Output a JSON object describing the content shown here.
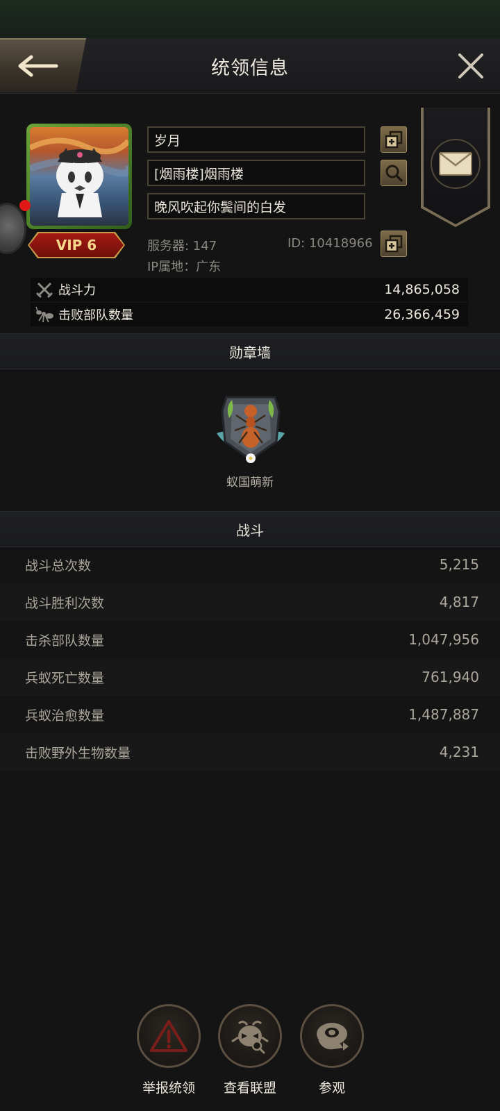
{
  "header": {
    "title": "统领信息"
  },
  "profile": {
    "name": "岁月",
    "alliance": "[烟雨楼]烟雨楼",
    "signature": "晚风吹起你鬓间的白发",
    "vip": "VIP 6",
    "server": "服务器: 147",
    "id": "ID: 10418966",
    "ip_location": "IP属地：广东"
  },
  "stats": [
    {
      "label": "战斗力",
      "value": "14,865,058",
      "icon": "crossed-swords-icon"
    },
    {
      "label": "击败部队数量",
      "value": "26,366,459",
      "icon": "ant-icon"
    }
  ],
  "medal_section": {
    "title": "勋章墙",
    "medal_name": "蚁国萌新"
  },
  "battle_section": {
    "title": "战斗",
    "rows": [
      {
        "label": "战斗总次数",
        "value": "5,215"
      },
      {
        "label": "战斗胜利次数",
        "value": "4,817"
      },
      {
        "label": "击杀部队数量",
        "value": "1,047,956"
      },
      {
        "label": "兵蚁死亡数量",
        "value": "761,940"
      },
      {
        "label": "兵蚁治愈数量",
        "value": "1,487,887"
      },
      {
        "label": "击败野外生物数量",
        "value": "4,231"
      }
    ]
  },
  "actions": [
    {
      "label": "举报统领",
      "icon": "warning-icon"
    },
    {
      "label": "查看联盟",
      "icon": "alliance-search-icon"
    },
    {
      "label": "参观",
      "icon": "visit-icon"
    }
  ],
  "colors": {
    "accent_gold": "#a08c60",
    "vip_red": "#a31a12",
    "background": "#141414"
  }
}
